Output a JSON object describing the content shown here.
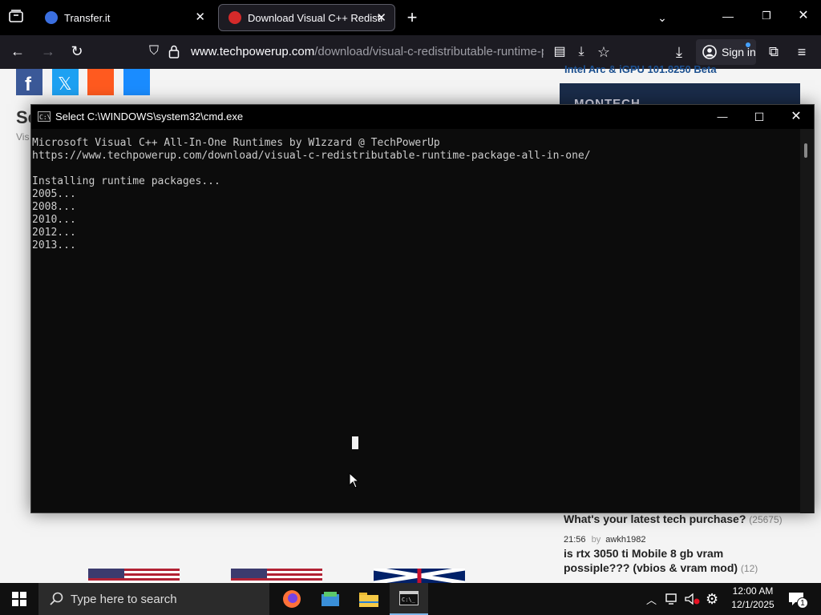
{
  "browser": {
    "tabs": [
      {
        "label": "Transfer.it",
        "active": false
      },
      {
        "label": "Download Visual C++ Redistrib",
        "active": true
      }
    ],
    "url_host": "www.techpowerup.com",
    "url_path": "/download/visual-c-redistributable-runtime-pack",
    "signin_label": "Sign in"
  },
  "page": {
    "heading_fragment": "Se",
    "sub_fragment": "Vis",
    "sidebar_top_link": "Intel Arc & iGPU 101.8250 Beta",
    "ad_text": "MONTECH",
    "forum_q1": "What's your latest tech purchase?",
    "forum_q1_count": "(25675)",
    "forum_time": "21:56",
    "forum_by": "by",
    "forum_user": "awkh1982",
    "forum_q2": "is rtx 3050 ti Mobile 8 gb vram possiple??? (vbios & vram mod)",
    "forum_q2_count": "(12)"
  },
  "cmd": {
    "title": "Select C:\\WINDOWS\\system32\\cmd.exe",
    "lines": [
      "Microsoft Visual C++ All-In-One Runtimes by W1zzard @ TechPowerUp",
      "https://www.techpowerup.com/download/visual-c-redistributable-runtime-package-all-in-one/",
      "",
      "Installing runtime packages...",
      "2005...",
      "2008...",
      "2010...",
      "2012...",
      "2013..."
    ]
  },
  "taskbar": {
    "search_placeholder": "Type here to search",
    "time": "12:00 AM",
    "date": "12/1/2025",
    "notification_count": "1"
  },
  "colors": {
    "cmd_bg": "#0c0c0c",
    "cmd_text": "#cccccc",
    "browser_bg": "#1c1b22",
    "link_blue": "#1b4f8f"
  }
}
